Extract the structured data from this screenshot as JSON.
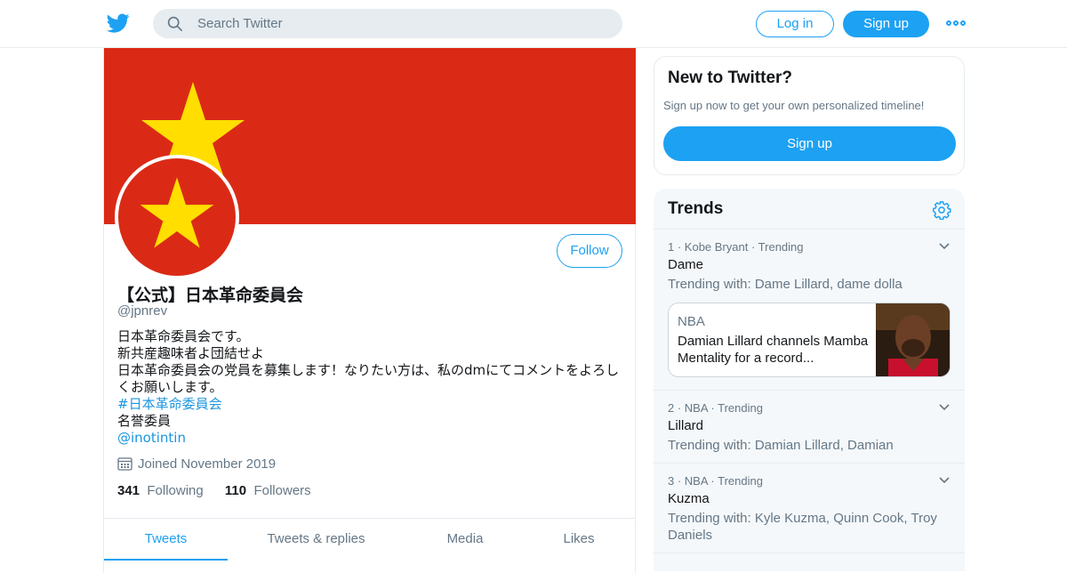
{
  "colors": {
    "accent": "#1da1f2",
    "banner": "#da2a16",
    "star": "#ffde00"
  },
  "topbar": {
    "logo_icon": "twitter-bird-icon",
    "search_placeholder": "Search Twitter",
    "login_label": "Log in",
    "signup_label": "Sign up",
    "more_icon": "more-dots-icon"
  },
  "profile": {
    "display_name": "【公式】日本革命委員会",
    "handle": "@jpnrev",
    "follow_label": "Follow",
    "bio": {
      "line1": "日本革命委員会です。",
      "line2": "新共産趣味者よ団結せよ",
      "line3": "日本革命委員会の党員を募集します！なりたい方は、私のdmにてコメントをよろし",
      "line4": "くお願いします。",
      "hashtag": "#日本革命委員会",
      "line5": "名誉委員",
      "mention": "@inotintin"
    },
    "joined": "Joined November 2019",
    "following_count": "341",
    "following_label": "Following",
    "followers_count": "110",
    "followers_label": "Followers",
    "tabs": [
      "Tweets",
      "Tweets & replies",
      "Media",
      "Likes"
    ]
  },
  "signup_card": {
    "title": "New to Twitter?",
    "subtitle": "Sign up now to get your own personalized timeline!",
    "button": "Sign up"
  },
  "trends": {
    "title": "Trends",
    "items": [
      {
        "rank": "1",
        "context": "Kobe Bryant",
        "status": "Trending",
        "name": "Dame",
        "with": "Trending with: Dame Lillard, dame dolla",
        "card": {
          "source": "NBA",
          "headline": "Damian Lillard channels Mamba Mentality for a record..."
        }
      },
      {
        "rank": "2",
        "context": "NBA",
        "status": "Trending",
        "name": "Lillard",
        "with": "Trending with: Damian Lillard, Damian"
      },
      {
        "rank": "3",
        "context": "NBA",
        "status": "Trending",
        "name": "Kuzma",
        "with": "Trending with: Kyle Kuzma, Quinn Cook, Troy Daniels"
      }
    ]
  }
}
